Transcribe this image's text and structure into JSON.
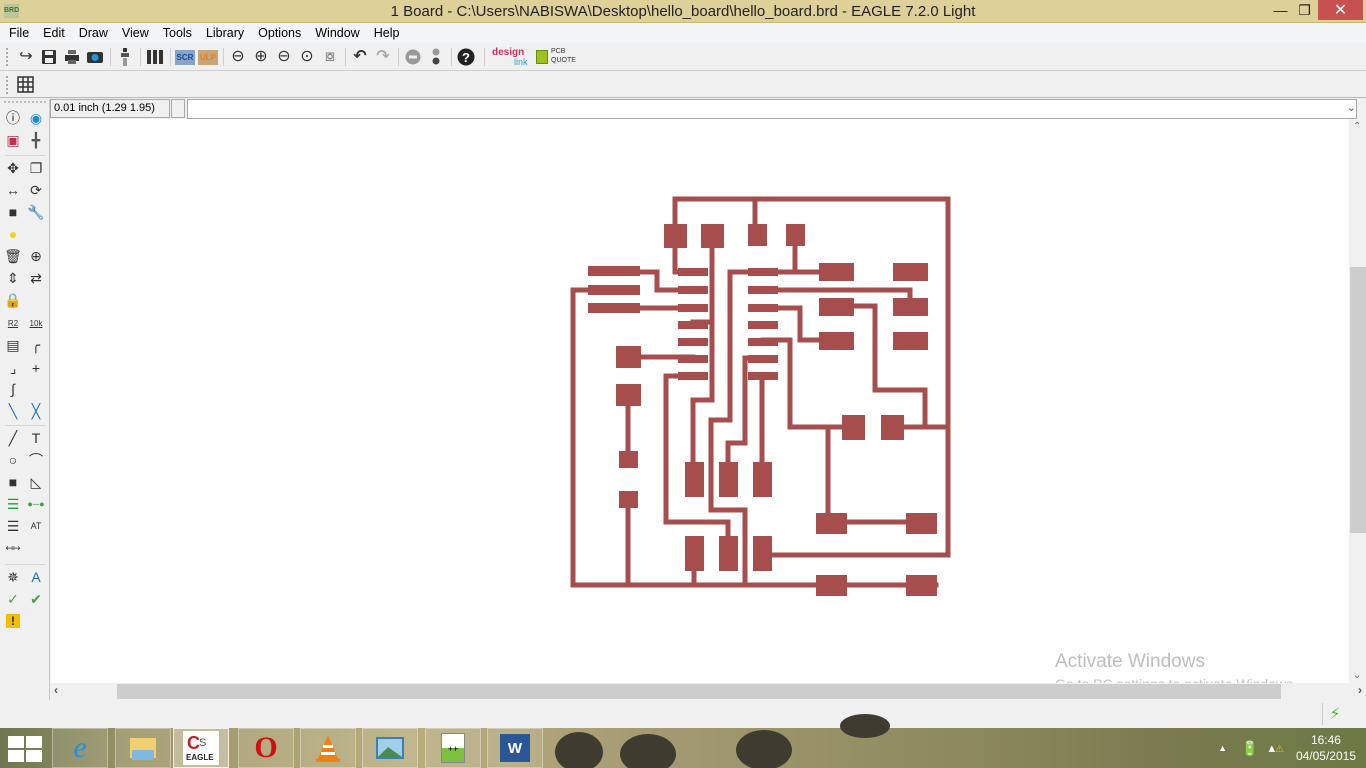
{
  "window": {
    "app_icon_label": "BRD",
    "title": "1 Board - C:\\Users\\NABISWA\\Desktop\\hello_board\\hello_board.brd - EAGLE 7.2.0 Light",
    "minimize_glyph": "—",
    "maximize_glyph": "❐",
    "close_glyph": "✕"
  },
  "menu": [
    "File",
    "Edit",
    "Draw",
    "View",
    "Tools",
    "Library",
    "Options",
    "Window",
    "Help"
  ],
  "toolbar": {
    "buttons": [
      {
        "name": "open-icon",
        "glyph": "↪"
      },
      {
        "name": "save-icon",
        "glyph": "🖫"
      },
      {
        "name": "print-icon",
        "glyph": "⎙"
      },
      {
        "name": "cam-processor-icon",
        "glyph": "●"
      },
      {
        "name": "switch-to-schematic-icon",
        "glyph": "‡"
      },
      {
        "name": "layer-settings-icon",
        "glyph": "Ⅱ"
      },
      {
        "name": "script-icon",
        "label": "SCR"
      },
      {
        "name": "ulp-icon",
        "label": "ULP"
      },
      {
        "name": "zoom-fit-icon",
        "glyph": "⊖"
      },
      {
        "name": "zoom-in-icon",
        "glyph": "⊕"
      },
      {
        "name": "zoom-out-icon",
        "glyph": "⊖"
      },
      {
        "name": "zoom-redraw-icon",
        "glyph": "⊙"
      },
      {
        "name": "zoom-select-icon",
        "glyph": "⧇"
      },
      {
        "name": "undo-icon",
        "glyph": "↶"
      },
      {
        "name": "redo-icon",
        "glyph": "↷"
      },
      {
        "name": "stop-icon",
        "glyph": "⊖"
      },
      {
        "name": "go-icon",
        "glyph": "⁚"
      },
      {
        "name": "help-icon",
        "glyph": "?"
      }
    ],
    "design_link_label_1": "design",
    "design_link_label_2": "link",
    "pcb_quote_label_1": "PCB",
    "pcb_quote_label_2": "QUOTE"
  },
  "toolbar2": {
    "grid_button": "grid-icon"
  },
  "command": {
    "coordinates": "0.01 inch (1.29 1.95)",
    "input_value": "",
    "dropdown_glyph": "⌄"
  },
  "tools": [
    {
      "name": "info-icon",
      "glyph": "ⓘ"
    },
    {
      "name": "show-icon",
      "glyph": "◉"
    },
    {
      "name": "display-layers-icon",
      "glyph": "▣"
    },
    {
      "name": "mark-icon",
      "glyph": "╋"
    },
    {
      "name": "move-icon",
      "glyph": "✥"
    },
    {
      "name": "copy-icon",
      "glyph": "❐"
    },
    {
      "name": "mirror-icon",
      "glyph": "↔"
    },
    {
      "name": "rotate-icon",
      "glyph": "⟳"
    },
    {
      "name": "group-icon",
      "glyph": "■"
    },
    {
      "name": "change-icon",
      "glyph": "🔧"
    },
    {
      "name": "paste-icon",
      "glyph": "●"
    },
    {
      "name": "delete-icon",
      "glyph": "🗑"
    },
    {
      "name": "add-icon",
      "glyph": "⊕"
    },
    {
      "name": "pinswap-icon",
      "glyph": "⇕"
    },
    {
      "name": "replace-icon",
      "glyph": "⇄"
    },
    {
      "name": "lock-icon",
      "glyph": "🔒"
    },
    {
      "name": "name-icon",
      "label": "R2"
    },
    {
      "name": "value-icon",
      "label": "10k"
    },
    {
      "name": "smash-icon",
      "glyph": "▤"
    },
    {
      "name": "miter-icon",
      "glyph": "╭"
    },
    {
      "name": "split-icon",
      "glyph": "⌟"
    },
    {
      "name": "optimize-icon",
      "glyph": "+"
    },
    {
      "name": "meander-icon",
      "glyph": "∫"
    },
    {
      "name": "route-icon",
      "glyph": "╲"
    },
    {
      "name": "ripup-icon",
      "glyph": "╳"
    },
    {
      "name": "wire-icon",
      "glyph": "╱"
    },
    {
      "name": "text-icon",
      "glyph": "T"
    },
    {
      "name": "circle-icon",
      "glyph": "○"
    },
    {
      "name": "arc-icon",
      "glyph": "⌒"
    },
    {
      "name": "rectangle-icon",
      "glyph": "■"
    },
    {
      "name": "polygon-icon",
      "glyph": "◺"
    },
    {
      "name": "via-icon",
      "glyph": "☰"
    },
    {
      "name": "signal-icon",
      "glyph": "●─●"
    },
    {
      "name": "hole-icon",
      "glyph": "☰"
    },
    {
      "name": "attribute-icon",
      "glyph": "AT"
    },
    {
      "name": "dimension-icon",
      "glyph": "↤↦"
    },
    {
      "name": "ratsnest-icon",
      "glyph": "✵"
    },
    {
      "name": "autorouter-icon",
      "glyph": "A"
    },
    {
      "name": "erc-icon",
      "glyph": "✓"
    },
    {
      "name": "drc-icon",
      "glyph": "✔"
    },
    {
      "name": "errors-icon",
      "glyph": "!"
    }
  ],
  "watermark": {
    "title": "Activate Windows",
    "subtitle": "Go to PC settings to activate Windows."
  },
  "taskbar": {
    "apps": [
      {
        "name": "internet-explorer-icon",
        "label": "e"
      },
      {
        "name": "file-explorer-icon",
        "label": ""
      },
      {
        "name": "eagle-icon",
        "label": "EAGLE"
      },
      {
        "name": "opera-icon",
        "label": "O"
      },
      {
        "name": "vlc-icon",
        "label": ""
      },
      {
        "name": "photos-icon",
        "label": ""
      },
      {
        "name": "notepad-plus-plus-icon",
        "label": "++"
      },
      {
        "name": "word-icon",
        "label": "W"
      }
    ],
    "time": "16:46",
    "date": "04/05/2015"
  },
  "colors": {
    "trace": "#a64d4d",
    "titlebar": "#ddd098",
    "close": "#c75050"
  }
}
